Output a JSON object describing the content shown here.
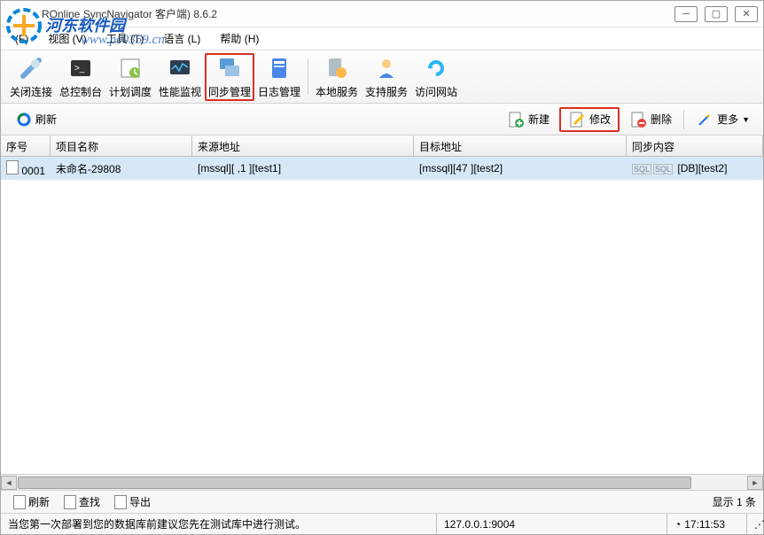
{
  "window": {
    "title": "ROnline SyncNavigator 客户端) 8.6.2"
  },
  "watermark": {
    "site_name": "河东软件园",
    "url": "www.pc0359.cn"
  },
  "menu": {
    "file": "(F)",
    "view": "视图 (V)",
    "tools": "工具 (T)",
    "language": "语言 (L)",
    "help": "帮助 (H)"
  },
  "toolbar": {
    "close_conn": "关闭连接",
    "console": "总控制台",
    "schedule": "计划调度",
    "perf": "性能监视",
    "sync_mgmt": "同步管理",
    "log_mgmt": "日志管理",
    "local_svc": "本地服务",
    "support": "支持服务",
    "visit_site": "访问网站"
  },
  "actions": {
    "refresh": "刷新",
    "new": "新建",
    "edit": "修改",
    "delete": "删除",
    "more": "更多"
  },
  "grid": {
    "headers": {
      "seq": "序号",
      "name": "项目名称",
      "src": "来源地址",
      "dst": "目标地址",
      "sync": "同步内容"
    },
    "rows": [
      {
        "seq": "0001",
        "name": "未命名-29808",
        "src": "[mssql][             ,1    ][test1]",
        "dst": "[mssql][47                 ][test2]",
        "sync": "[DB][test2]"
      }
    ]
  },
  "footer": {
    "refresh": "刷新",
    "find": "查找",
    "export": "导出",
    "count": "显示 1 条"
  },
  "status": {
    "message": "当您第一次部署到您的数据库前建议您先在测试库中进行测试。",
    "address": "127.0.0.1:9004",
    "time": "17:11:53"
  }
}
